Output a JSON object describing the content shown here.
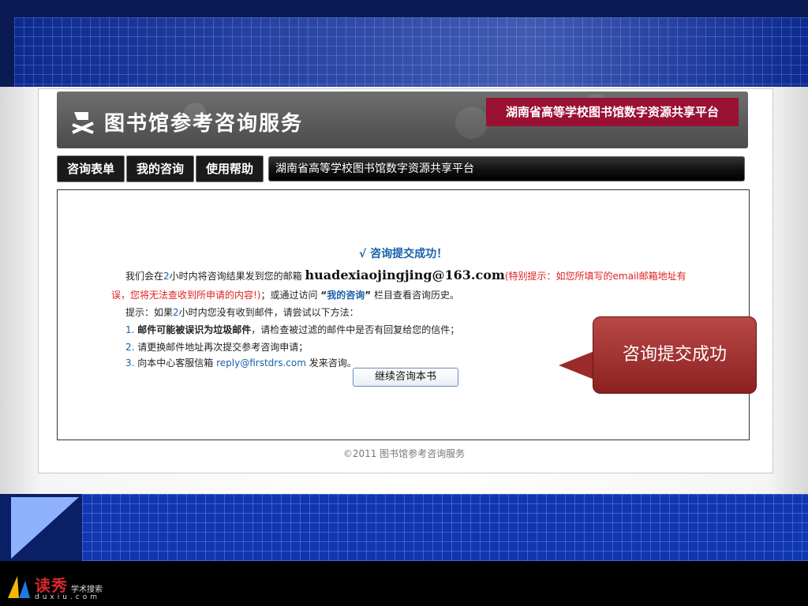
{
  "site": {
    "title": "图书馆参考咨询服务",
    "platform": "湖南省高等学校图书馆数字资源共享平台"
  },
  "nav": {
    "tabs": [
      "咨询表单",
      "我的咨询",
      "使用帮助"
    ],
    "bar_text": "湖南省高等学校图书馆数字资源共享平台"
  },
  "content": {
    "success": "√ 咨询提交成功！",
    "line1_prefix": "我们会在",
    "line1_hours": "2",
    "line1_mid": "小时内将咨询结果发到您的邮箱",
    "email": "huadexiaojingjing@163.com",
    "line1_hint": "(特别提示：如您所填写的email邮箱地址有",
    "line2_red": "误，您将无法查收到所申请的内容!)",
    "line2_rest1": "；或通过访问 ",
    "line2_quote_open": "“",
    "line2_link": "我的咨询",
    "line2_quote_close": "”",
    "line2_rest2": " 栏目查看咨询历史。",
    "tip_prefix": "提示：如果",
    "tip_hours": "2",
    "tip_rest": "小时内您没有收到邮件，请尝试以下方法：",
    "step1_num": "1.",
    "step1_bold": "邮件可能被误识为垃圾邮件",
    "step1_rest": "，请检查被过滤的邮件中是否有回复给您的信件；",
    "step2_num": "2.",
    "step2": "请更换邮件地址再次提交参考咨询申请；",
    "step3_num": "3.",
    "step3_prefix": "向本中心客服信箱 ",
    "step3_email": "reply@firstdrs.com",
    "step3_rest": " 发来咨询。",
    "continue_button": "继续咨询本书",
    "copyright": "©2011 图书馆参考咨询服务"
  },
  "callout": {
    "text": "咨询提交成功"
  },
  "logo": {
    "title": "读秀",
    "subtitle": "学术搜索",
    "url": "duxiu.com"
  },
  "colors": {
    "badge": "#9a1033",
    "callout": "#a63333",
    "link_blue": "#1a5fa8",
    "warning_red": "#e02020"
  }
}
